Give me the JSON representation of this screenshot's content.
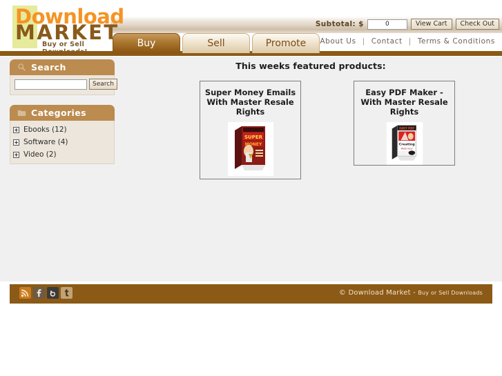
{
  "site": {
    "logo_primary": "Download",
    "logo_secondary": "MARKET",
    "logo_tagline_line1": "Buy or Sell",
    "logo_tagline_line2": "Downloads!"
  },
  "cart": {
    "subtotal_label": "Subtotal: $",
    "subtotal_value": "0",
    "view_cart_label": "View Cart",
    "check_out_label": "Check Out"
  },
  "nav": {
    "tabs": [
      {
        "label": "Buy",
        "active": true
      },
      {
        "label": "Sell",
        "active": false
      },
      {
        "label": "Promote",
        "active": false
      }
    ],
    "links": [
      {
        "label": "About Us"
      },
      {
        "label": "Contact"
      },
      {
        "label": "Terms & Conditions"
      }
    ],
    "separator": "|"
  },
  "sidebar": {
    "search": {
      "title": "Search",
      "icon": "magnifier-icon",
      "input_value": "",
      "placeholder": "",
      "button_label": "Search"
    },
    "categories": {
      "title": "Categories",
      "icon": "folder-icon",
      "items": [
        {
          "label": "Ebooks (12)",
          "icon": "plus-box-icon"
        },
        {
          "label": "Software (4)",
          "icon": "plus-box-icon"
        },
        {
          "label": "Video (2)",
          "icon": "plus-box-icon"
        }
      ]
    }
  },
  "main": {
    "featured_heading": "This weeks featured products:",
    "products": [
      {
        "title": "Super Money Emails With Master Resale Rights",
        "image_alt": "super-money-emails-box-shot"
      },
      {
        "title": "Easy PDF Maker - With Master Resale Rights",
        "image_alt": "easy-pdf-maker-box-shot"
      }
    ]
  },
  "footer": {
    "social": [
      {
        "name": "rss-icon",
        "glyph": "RSS"
      },
      {
        "name": "facebook-icon",
        "glyph": "f"
      },
      {
        "name": "stumbleupon-icon",
        "glyph": "hand"
      },
      {
        "name": "twitter-icon",
        "glyph": "t"
      }
    ],
    "copyright_main": "© Download Market",
    "copyright_sep": " - ",
    "copyright_small": "Buy or Sell Downloads"
  },
  "colors": {
    "brand_orange": "#f59323",
    "brand_brown": "#8a5a19",
    "nav_bar": "#8b5a16",
    "panel_head": "#bb8b4f",
    "panel_body": "#ece6dc",
    "page_bg": "#f0f0f0"
  }
}
